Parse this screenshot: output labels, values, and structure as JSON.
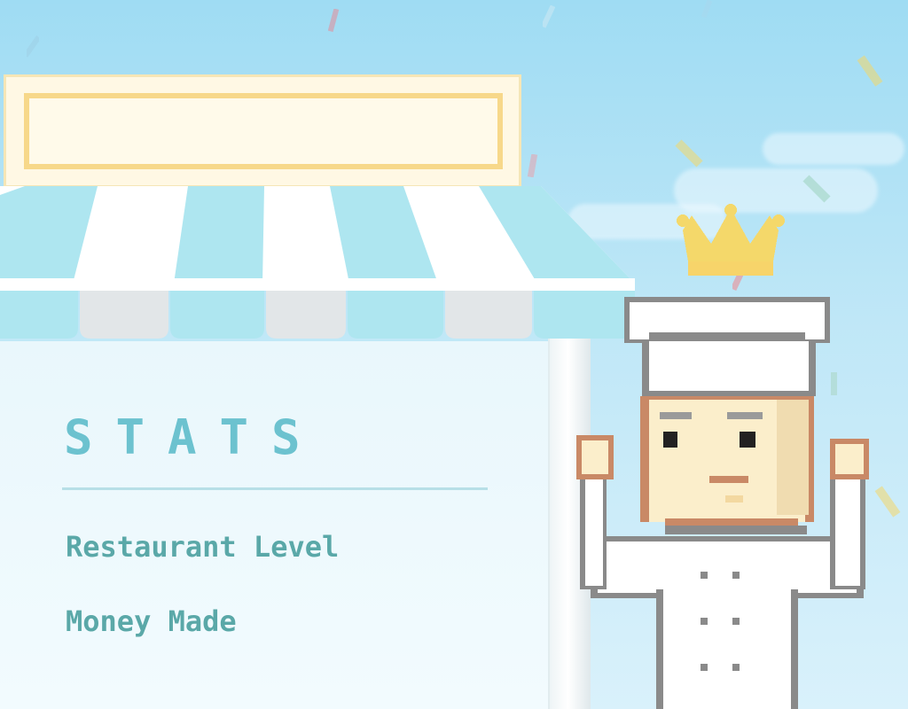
{
  "stats_panel": {
    "title": "STATS",
    "items": [
      {
        "label": "Restaurant Level"
      },
      {
        "label": "Money Made"
      }
    ]
  },
  "colors": {
    "sky": "#9fdcf3",
    "awning_blue": "#aee6f0",
    "awning_white": "#ffffff",
    "awning_scallop_gray": "#e2e6e8",
    "sign_border": "#f7d88a",
    "stats_text": "#5aa8a8",
    "crown": "#f4d86a",
    "chef_skin": "#fbeecb",
    "chef_outline": "#8a8a8a"
  },
  "icons": {
    "chef": "chef-character-icon",
    "crown": "crown-icon"
  }
}
